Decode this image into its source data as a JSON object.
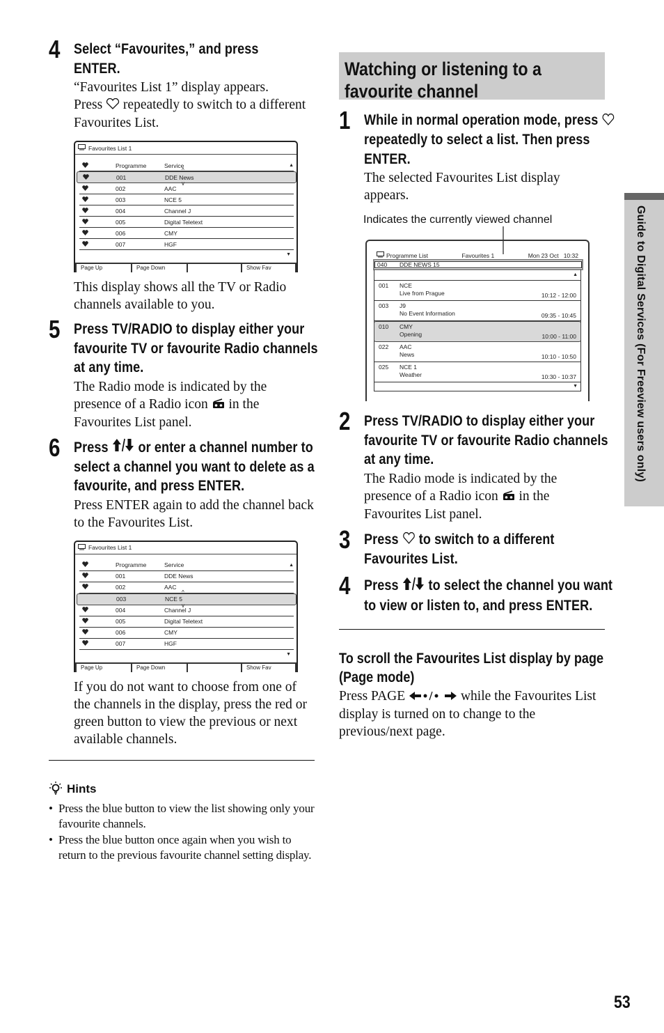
{
  "left_column": {
    "step4": {
      "number": "4",
      "title": "Select “Favourites,” and press ENTER.",
      "body_line1": "“Favourites List 1” display appears.",
      "body_pre": "Press",
      "body_post": "repeatedly to switch to a different Favourites List."
    },
    "panel1": {
      "title": "Favourites List 1",
      "header": {
        "programme": "Programme",
        "service": "Service"
      },
      "rows": [
        {
          "prog": "001",
          "service": "DDE News",
          "fav": true,
          "selected": true
        },
        {
          "prog": "002",
          "service": "AAC",
          "fav": true,
          "selected": false
        },
        {
          "prog": "003",
          "service": "NCE 5",
          "fav": true,
          "selected": false
        },
        {
          "prog": "004",
          "service": "Channel J",
          "fav": true,
          "selected": false
        },
        {
          "prog": "005",
          "service": "Digital Teletext",
          "fav": true,
          "selected": false
        },
        {
          "prog": "006",
          "service": "CMY",
          "fav": true,
          "selected": false
        },
        {
          "prog": "007",
          "service": "HGF",
          "fav": true,
          "selected": false
        }
      ],
      "footer": [
        "Page Up",
        "Page Down",
        "",
        "Show Fav"
      ]
    },
    "panel1_caption": "This display shows all the TV or Radio channels available to you.",
    "step5": {
      "number": "5",
      "title": "Press TV/RADIO to display either your favourite TV or favourite Radio channels at any time.",
      "body_pre": "The Radio mode is indicated by the presence of a Radio icon",
      "body_post": "in the Favourites List panel."
    },
    "step6": {
      "number": "6",
      "title_pre": "Press",
      "title_post": "or enter a channel number to select a channel you want to delete as a favourite, and press ENTER.",
      "body": "Press ENTER again to add the channel back to the Favourites List."
    },
    "panel2": {
      "title": "Favourites List 1",
      "header": {
        "programme": "Programme",
        "service": "Service"
      },
      "rows": [
        {
          "prog": "001",
          "service": "DDE News",
          "fav": true,
          "selected": false
        },
        {
          "prog": "002",
          "service": "AAC",
          "fav": true,
          "selected": false
        },
        {
          "prog": "003",
          "service": "NCE 5",
          "fav": false,
          "selected": true
        },
        {
          "prog": "004",
          "service": "Channel J",
          "fav": true,
          "selected": false
        },
        {
          "prog": "005",
          "service": "Digital Teletext",
          "fav": true,
          "selected": false
        },
        {
          "prog": "006",
          "service": "CMY",
          "fav": true,
          "selected": false
        },
        {
          "prog": "007",
          "service": "HGF",
          "fav": true,
          "selected": false
        }
      ],
      "footer": [
        "Page Up",
        "Page Down",
        "",
        "Show Fav"
      ]
    },
    "panel2_caption": "If you do not want to choose from one of the channels in the display, press the red or green button to view the previous or next available channels.",
    "hints": {
      "title": "Hints",
      "items": [
        "Press the blue button to view the list showing only your favourite channels.",
        "Press the blue button once again when you wish to return to the previous favourite channel setting display."
      ]
    }
  },
  "right_column": {
    "section_title": "Watching or listening to a favourite channel",
    "step1": {
      "number": "1",
      "title_pre": "While in normal operation mode, press",
      "title_post": "repeatedly to select a list. Then press ENTER.",
      "body": "The selected Favourites List display appears."
    },
    "annotation": "Indicates the currently viewed channel",
    "programme_list": {
      "title": "Programme List",
      "list_name": "Favourites 1",
      "date_time": "Mon 23 Oct   10:32",
      "current": {
        "num": "040",
        "name": "DDE NEWS 15"
      },
      "rows": [
        {
          "num": "001",
          "name": "NCE",
          "event": "Live from Prague",
          "time": "10:12 - 12:00",
          "selected": false
        },
        {
          "num": "003",
          "name": "J9",
          "event": "No Event Information",
          "time": "09:35 - 10:45",
          "selected": false
        },
        {
          "num": "010",
          "name": "CMY",
          "event": "Opening",
          "time": "10:00 - 11:00",
          "selected": true
        },
        {
          "num": "022",
          "name": "AAC",
          "event": "News",
          "time": "10:10 - 10:50",
          "selected": false
        },
        {
          "num": "025",
          "name": "NCE 1",
          "event": "Weather",
          "time": "10:30 - 10:37",
          "selected": false
        }
      ]
    },
    "step2": {
      "number": "2",
      "title": "Press TV/RADIO to display either your favourite TV or favourite Radio channels at any time.",
      "body_pre": "The Radio mode is indicated by the presence of a Radio icon",
      "body_post": "in the Favourites List panel."
    },
    "step3": {
      "number": "3",
      "title_pre": "Press",
      "title_post": "to switch to a different Favourites List."
    },
    "step4": {
      "number": "4",
      "title_pre": "Press",
      "title_post": "to select the channel you want to view or listen to, and press ENTER."
    },
    "scroll": {
      "title": "To scroll the Favourites List display by page (Page mode)",
      "body_pre": "Press PAGE",
      "body_post": "while the Favourites List display is turned on to change to the previous/next page."
    }
  },
  "side_tab": "Guide to Digital Services (For Freeview users only)",
  "page_number": "53",
  "colors": {
    "section_bg": "#cccccc",
    "selected_row": "#d9d9d9",
    "tab_bar": "#666666"
  }
}
